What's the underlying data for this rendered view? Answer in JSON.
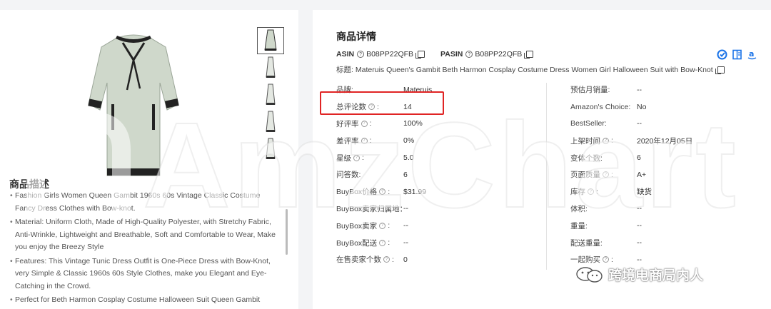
{
  "product": {
    "thumbnail_count": 5
  },
  "description": {
    "title": "商品描述",
    "bullets": [
      "Fashion Girls Women Queen Gambit 1960s 60s Vintage Classic Costume Fancy Dress Clothes with Bow-knot.",
      "Material: Uniform Cloth, Made of High-Quality Polyester, with Stretchy Fabric, Anti-Wrinkle, Lightweight and Breathable, Soft and Comfortable to Wear, Make you enjoy the Breezy Style",
      "Features: This Vintage Tunic Dress Outfit is One-Piece Dress with Bow-Knot, very Simple & Classic 1960s 60s Style Clothes, make you Elegant and Eye-Catching in the Crowd.",
      "Perfect for Beth Harmon Cosplay Costume Halloween Suit Queen Gambit"
    ]
  },
  "details": {
    "section_title": "商品详情",
    "asin_label": "ASIN",
    "asin_value": "B08PP22QFB",
    "pasin_label": "PASIN",
    "pasin_value": "B08PP22QFB",
    "title_label": "标题:",
    "title_value": "Materuis Queen's Gambit Beth Harmon Cosplay Costume Dress Women Girl Halloween Suit with Bow-Knot",
    "left_rows": [
      {
        "key": "品牌:",
        "value": "Materuis"
      },
      {
        "key": "总评论数",
        "value": "14"
      },
      {
        "key": "好评率",
        "value": "100%"
      },
      {
        "key": "差评率",
        "value": "0%"
      },
      {
        "key": "星级",
        "value": "5.0"
      },
      {
        "key": "问答数:",
        "value": "6"
      },
      {
        "key": "BuyBox价格",
        "value": "$31.99"
      },
      {
        "key": "BuyBox卖家归属地：",
        "value": "--"
      },
      {
        "key": "BuyBox卖家",
        "value": "--"
      },
      {
        "key": "BuyBox配送",
        "value": "--"
      },
      {
        "key": "在售卖家个数",
        "value": "0"
      }
    ],
    "right_rows": [
      {
        "key": "预估月销量:",
        "value": "--"
      },
      {
        "key": "Amazon's Choice:",
        "value": "No"
      },
      {
        "key": "BestSeller:",
        "value": "--"
      },
      {
        "key": "上架时间",
        "value": "2020年12月05日"
      },
      {
        "key": "变体个数:",
        "value": "6"
      },
      {
        "key": "页面质量",
        "value": "A+"
      },
      {
        "key": "库存",
        "value": "缺货"
      },
      {
        "key": "体积:",
        "value": "--"
      },
      {
        "key": "重量:",
        "value": "--"
      },
      {
        "key": "配送重量:",
        "value": "--"
      },
      {
        "key": "一起购买",
        "value": "--"
      }
    ]
  },
  "watermark": {
    "text": "AmzChart",
    "wechat_name": "跨境电商局内人"
  },
  "colors": {
    "highlight": "#e02424",
    "accent_blue": "#1a73e8"
  }
}
